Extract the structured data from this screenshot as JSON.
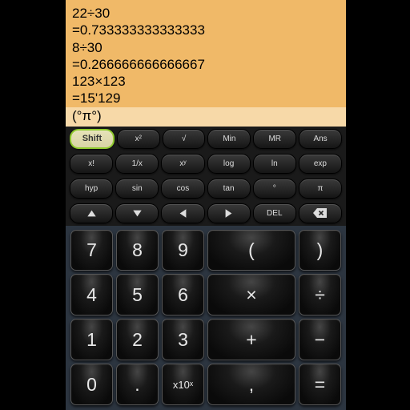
{
  "display": {
    "lines": [
      "22÷30",
      "=0.733333333333333",
      "8÷30",
      "=0.266666666666667",
      "123×123",
      "=15'129"
    ],
    "input": "(°π°)"
  },
  "fn": {
    "r1": [
      "Shift",
      "x²",
      "√",
      "Min",
      "MR",
      "Ans"
    ],
    "r2": [
      "x!",
      "1/x",
      "xʸ",
      "log",
      "ln",
      "exp"
    ],
    "r3": [
      "hyp",
      "sin",
      "cos",
      "tan",
      "°",
      "π"
    ],
    "r4": [
      "◂",
      "▸",
      "▴",
      "▸",
      "DEL",
      "⌫"
    ]
  },
  "num": {
    "r1": [
      "7",
      "8",
      "9",
      "(",
      ")"
    ],
    "r2": [
      "4",
      "5",
      "6",
      "×",
      "÷"
    ],
    "r3": [
      "1",
      "2",
      "3",
      "+",
      "−"
    ],
    "r4": [
      "0",
      ".",
      "x10ˣ",
      ",",
      "="
    ]
  }
}
